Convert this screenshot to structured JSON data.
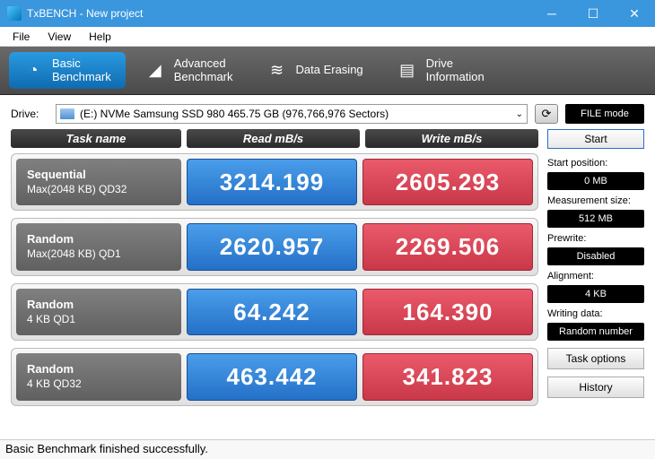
{
  "window": {
    "title": "TxBENCH - New project"
  },
  "menu": {
    "file": "File",
    "view": "View",
    "help": "Help"
  },
  "tabs": {
    "basic": "Basic\nBenchmark",
    "advanced": "Advanced\nBenchmark",
    "erase": "Data Erasing",
    "drive": "Drive\nInformation"
  },
  "drive": {
    "label": "Drive:",
    "value": "(E:) NVMe Samsung SSD 980  465.75 GB (976,766,976 Sectors)"
  },
  "filemode": "FILE mode",
  "headers": {
    "task": "Task name",
    "read": "Read mB/s",
    "write": "Write mB/s"
  },
  "rows": [
    {
      "t1": "Sequential",
      "t2": "Max(2048 KB) QD32",
      "read": "3214.199",
      "write": "2605.293"
    },
    {
      "t1": "Random",
      "t2": "Max(2048 KB) QD1",
      "read": "2620.957",
      "write": "2269.506"
    },
    {
      "t1": "Random",
      "t2": "4 KB QD1",
      "read": "64.242",
      "write": "164.390"
    },
    {
      "t1": "Random",
      "t2": "4 KB QD32",
      "read": "463.442",
      "write": "341.823"
    }
  ],
  "side": {
    "start": "Start",
    "startpos_lbl": "Start position:",
    "startpos": "0 MB",
    "meas_lbl": "Measurement size:",
    "meas": "512 MB",
    "prewrite_lbl": "Prewrite:",
    "prewrite": "Disabled",
    "align_lbl": "Alignment:",
    "align": "4 KB",
    "wdata_lbl": "Writing data:",
    "wdata": "Random number",
    "taskopt": "Task options",
    "history": "History"
  },
  "status": "Basic Benchmark finished successfully."
}
